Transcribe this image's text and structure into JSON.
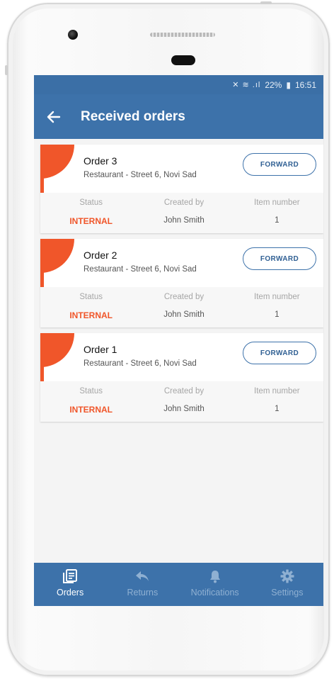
{
  "status_bar": {
    "icons": "✕ ≋ .ıl",
    "battery": "22%",
    "battery_icon": "▮",
    "time": "16:51"
  },
  "app_bar": {
    "title": "Received orders",
    "back_icon": "arrow-left-icon"
  },
  "orders": [
    {
      "title": "Order 3",
      "subtitle": "Restaurant - Street 6, Novi Sad",
      "forward_label": "FORWARD",
      "status_label": "Status",
      "status_value": "INTERNAL",
      "created_label": "Created by",
      "created_value": "John Smith",
      "items_label": "Item number",
      "items_value": "1"
    },
    {
      "title": "Order 2",
      "subtitle": "Restaurant - Street 6, Novi Sad",
      "forward_label": "FORWARD",
      "status_label": "Status",
      "status_value": "INTERNAL",
      "created_label": "Created by",
      "created_value": "John Smith",
      "items_label": "Item number",
      "items_value": "1"
    },
    {
      "title": "Order 1",
      "subtitle": "Restaurant - Street 6, Novi Sad",
      "forward_label": "FORWARD",
      "status_label": "Status",
      "status_value": "INTERNAL",
      "created_label": "Created by",
      "created_value": "John Smith",
      "items_label": "Item number",
      "items_value": "1"
    }
  ],
  "bottom_nav": [
    {
      "label": "Orders",
      "icon": "orders-icon",
      "active": true
    },
    {
      "label": "Returns",
      "icon": "reply-icon",
      "active": false
    },
    {
      "label": "Notifications",
      "icon": "bell-icon",
      "active": false
    },
    {
      "label": "Settings",
      "icon": "gear-icon",
      "active": false
    }
  ],
  "colors": {
    "primary": "#3d72aa",
    "accent": "#f0562a",
    "nav_inactive": "#8fb0d2"
  }
}
